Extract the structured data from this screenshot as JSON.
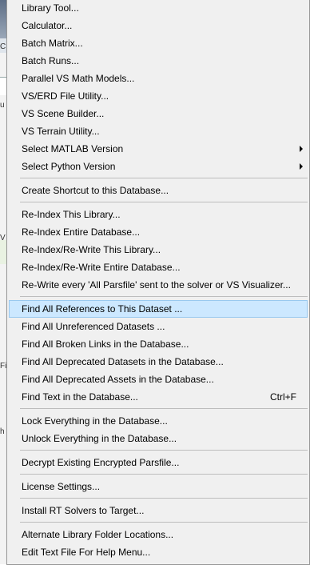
{
  "menu": {
    "items": [
      {
        "label": "Library Tool...",
        "shortcut": "",
        "submenu": false,
        "highlighted": false
      },
      {
        "label": "Calculator...",
        "shortcut": "",
        "submenu": false,
        "highlighted": false
      },
      {
        "label": "Batch Matrix...",
        "shortcut": "",
        "submenu": false,
        "highlighted": false
      },
      {
        "label": "Batch Runs...",
        "shortcut": "",
        "submenu": false,
        "highlighted": false
      },
      {
        "label": "Parallel VS Math Models...",
        "shortcut": "",
        "submenu": false,
        "highlighted": false
      },
      {
        "label": "VS/ERD File Utility...",
        "shortcut": "",
        "submenu": false,
        "highlighted": false
      },
      {
        "label": "VS Scene Builder...",
        "shortcut": "",
        "submenu": false,
        "highlighted": false
      },
      {
        "label": "VS Terrain Utility...",
        "shortcut": "",
        "submenu": false,
        "highlighted": false
      },
      {
        "label": "Select MATLAB Version",
        "shortcut": "",
        "submenu": true,
        "highlighted": false
      },
      {
        "label": "Select Python Version",
        "shortcut": "",
        "submenu": true,
        "highlighted": false
      },
      {
        "label": "Create Shortcut to this Database...",
        "shortcut": "",
        "submenu": false,
        "highlighted": false
      },
      {
        "label": "Re-Index This Library...",
        "shortcut": "",
        "submenu": false,
        "highlighted": false
      },
      {
        "label": "Re-Index Entire Database...",
        "shortcut": "",
        "submenu": false,
        "highlighted": false
      },
      {
        "label": "Re-Index/Re-Write This Library...",
        "shortcut": "",
        "submenu": false,
        "highlighted": false
      },
      {
        "label": "Re-Index/Re-Write Entire Database...",
        "shortcut": "",
        "submenu": false,
        "highlighted": false
      },
      {
        "label": "Re-Write every 'All Parsfile' sent to the solver or VS Visualizer...",
        "shortcut": "",
        "submenu": false,
        "highlighted": false
      },
      {
        "label": "Find All References to This Dataset ...",
        "shortcut": "",
        "submenu": false,
        "highlighted": true
      },
      {
        "label": "Find All Unreferenced Datasets ...",
        "shortcut": "",
        "submenu": false,
        "highlighted": false
      },
      {
        "label": "Find All Broken Links in the Database...",
        "shortcut": "",
        "submenu": false,
        "highlighted": false
      },
      {
        "label": "Find All Deprecated Datasets in the Database...",
        "shortcut": "",
        "submenu": false,
        "highlighted": false
      },
      {
        "label": "Find All Deprecated Assets in the Database...",
        "shortcut": "",
        "submenu": false,
        "highlighted": false
      },
      {
        "label": "Find Text in the Database...",
        "shortcut": "Ctrl+F",
        "submenu": false,
        "highlighted": false
      },
      {
        "label": "Lock Everything in the Database...",
        "shortcut": "",
        "submenu": false,
        "highlighted": false
      },
      {
        "label": "Unlock Everything in the Database...",
        "shortcut": "",
        "submenu": false,
        "highlighted": false
      },
      {
        "label": "Decrypt Existing Encrypted Parsfile...",
        "shortcut": "",
        "submenu": false,
        "highlighted": false
      },
      {
        "label": "License Settings...",
        "shortcut": "",
        "submenu": false,
        "highlighted": false
      },
      {
        "label": "Install RT Solvers to Target...",
        "shortcut": "",
        "submenu": false,
        "highlighted": false
      },
      {
        "label": "Alternate Library Folder Locations...",
        "shortcut": "",
        "submenu": false,
        "highlighted": false
      },
      {
        "label": "Edit Text File For Help Menu...",
        "shortcut": "",
        "submenu": false,
        "highlighted": false
      }
    ],
    "separators_after": [
      9,
      10,
      15,
      21,
      23,
      24,
      25,
      26
    ]
  },
  "background": {
    "fragments": [
      "C",
      "u",
      "V",
      "Fi",
      "h"
    ]
  }
}
